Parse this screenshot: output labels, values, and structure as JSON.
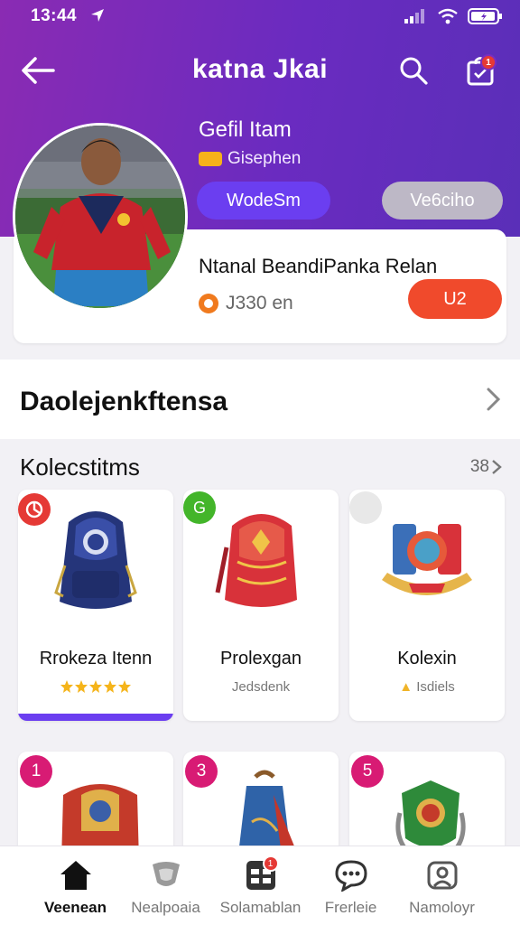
{
  "status": {
    "time": "13:44"
  },
  "header": {
    "title": "katna Jkai"
  },
  "profile": {
    "name": "Gefil Itam",
    "subtitle": "Gisephen",
    "primary_button": "WodeSm",
    "secondary_button": "Ve6ciho"
  },
  "info": {
    "title": "Ntanal BeandiPanka Relan",
    "price": "J330 en",
    "button": "U2"
  },
  "section": {
    "title": "Daolejenkftensa"
  },
  "collection": {
    "title": "Kolecstitms",
    "count": "38",
    "cards": [
      {
        "name": "Rrokeza Itenn",
        "sub": "",
        "badge": "",
        "badge_color": "#e53935"
      },
      {
        "name": "Prolexgan",
        "sub": "Jedsdenk",
        "badge": "G",
        "badge_color": "#43b52a"
      },
      {
        "name": "Kolexin",
        "sub": "Isdiels",
        "badge": "",
        "badge_color": "#e0e0e0"
      }
    ],
    "cards2": [
      {
        "badge": "1"
      },
      {
        "badge": "3"
      },
      {
        "badge": "5"
      }
    ]
  },
  "tabs": [
    {
      "label": "Veenean",
      "icon": "home-icon",
      "active": true
    },
    {
      "label": "Nealpoaia",
      "icon": "shield-icon",
      "active": false
    },
    {
      "label": "Solamablan",
      "icon": "grid-icon",
      "active": false,
      "badge": "1"
    },
    {
      "label": "Frerleie",
      "icon": "chat-icon",
      "active": false
    },
    {
      "label": "Namoloyr",
      "icon": "profile-icon",
      "active": false
    }
  ],
  "colors": {
    "accent": "#6b3ef0",
    "header_start": "#8a2bb3",
    "header_end": "#5a2fb8",
    "cta": "#f04a2c"
  }
}
